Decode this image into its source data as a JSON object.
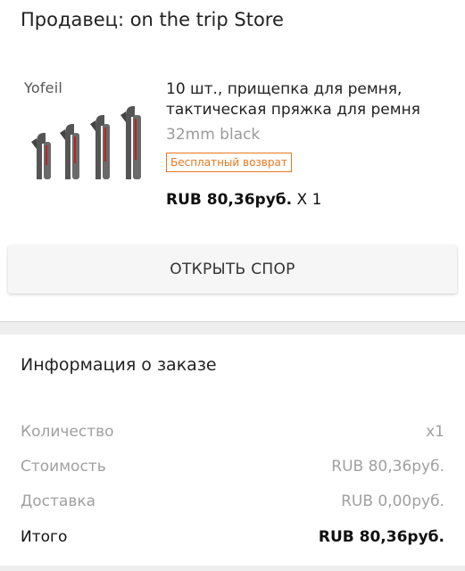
{
  "seller": {
    "title": "Продавец: on the trip Store"
  },
  "product": {
    "brand": "Yofeil",
    "image_alt": "belt-clip-product-image",
    "title": "10 шт., прищепка для ремня, тактическая пряжка для ремня",
    "variant": "32mm  black",
    "badge": "Бесплатный возврат",
    "price": "RUB 80,36руб.",
    "quantity": "X 1"
  },
  "actions": {
    "dispute_label": "ОТКРЫТЬ СПОР"
  },
  "order_info": {
    "title": "Информация о заказе",
    "rows": [
      {
        "label": "Количество",
        "value": "x1"
      },
      {
        "label": "Стоимость",
        "value": "RUB 80,36руб."
      },
      {
        "label": "Доставка",
        "value": "RUB 0,00руб."
      },
      {
        "label": "Итого",
        "value": "RUB 80,36руб."
      }
    ]
  },
  "colors": {
    "badge": "#e8781f",
    "muted_text": "#a0a0a0",
    "divider": "#eeeeee"
  }
}
